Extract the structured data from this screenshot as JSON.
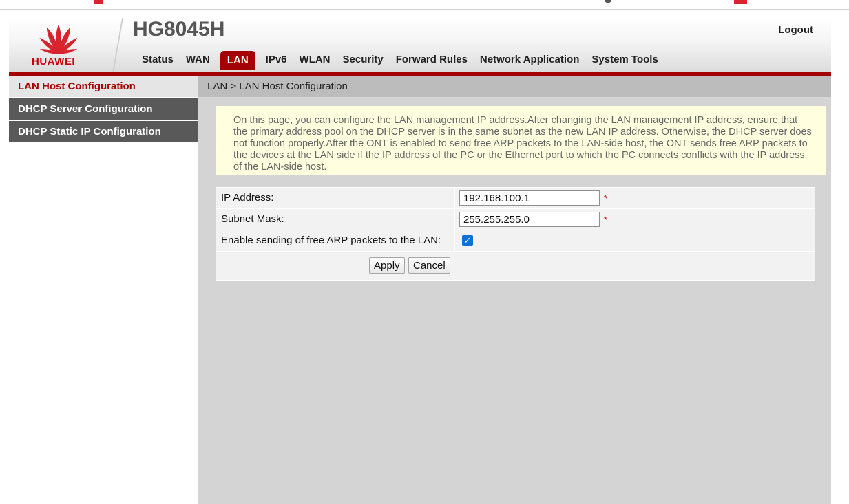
{
  "brand": {
    "logo_text": "HUAWEI",
    "product": "HG8045H",
    "accent": "#a50000"
  },
  "header": {
    "logout": "Logout"
  },
  "nav": [
    {
      "label": "Status"
    },
    {
      "label": "WAN"
    },
    {
      "label": "LAN",
      "active": true
    },
    {
      "label": "IPv6"
    },
    {
      "label": "WLAN"
    },
    {
      "label": "Security"
    },
    {
      "label": "Forward Rules"
    },
    {
      "label": "Network Application"
    },
    {
      "label": "System Tools"
    }
  ],
  "sidebar": {
    "items": [
      {
        "label": "LAN Host Configuration",
        "active": true
      },
      {
        "label": "DHCP Server Configuration"
      },
      {
        "label": "DHCP Static IP Configuration"
      }
    ]
  },
  "breadcrumb": "LAN > LAN Host Configuration",
  "info_text": "On this page, you can configure the LAN management IP address.After changing the LAN management IP address, ensure that the primary address pool on the DHCP server is in the same subnet as the new LAN IP address. Otherwise, the DHCP server does not function properly.After the ONT is enabled to send free ARP packets to the LAN-side host, the ONT sends free ARP packets to the devices at the LAN side if the IP address of the PC or the Ethernet port to which the PC connects conflicts with the IP address of the LAN-side host.",
  "form": {
    "ip_label": "IP Address:",
    "ip_value": "192.168.100.1",
    "mask_label": "Subnet Mask:",
    "mask_value": "255.255.255.0",
    "arp_label": "Enable sending of free ARP packets to the LAN:",
    "arp_checked": true,
    "required_mark": "*",
    "apply": "Apply",
    "cancel": "Cancel"
  }
}
